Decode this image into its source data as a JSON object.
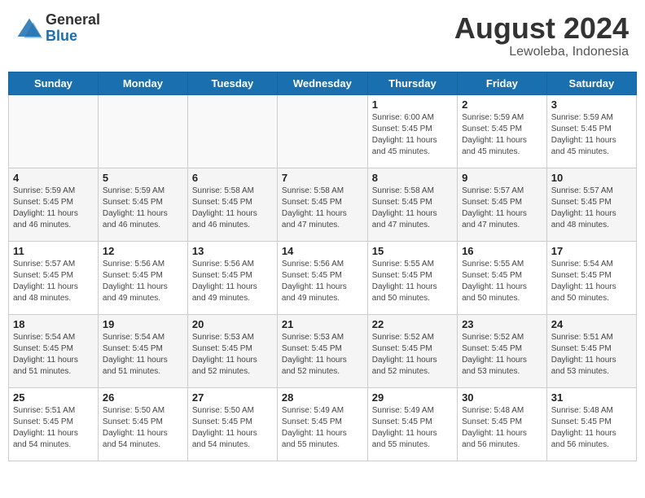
{
  "header": {
    "logo_general": "General",
    "logo_blue": "Blue",
    "month_year": "August 2024",
    "location": "Lewoleba, Indonesia"
  },
  "days_of_week": [
    "Sunday",
    "Monday",
    "Tuesday",
    "Wednesday",
    "Thursday",
    "Friday",
    "Saturday"
  ],
  "weeks": [
    [
      {
        "day": "",
        "info": ""
      },
      {
        "day": "",
        "info": ""
      },
      {
        "day": "",
        "info": ""
      },
      {
        "day": "",
        "info": ""
      },
      {
        "day": "1",
        "info": "Sunrise: 6:00 AM\nSunset: 5:45 PM\nDaylight: 11 hours\nand 45 minutes."
      },
      {
        "day": "2",
        "info": "Sunrise: 5:59 AM\nSunset: 5:45 PM\nDaylight: 11 hours\nand 45 minutes."
      },
      {
        "day": "3",
        "info": "Sunrise: 5:59 AM\nSunset: 5:45 PM\nDaylight: 11 hours\nand 45 minutes."
      }
    ],
    [
      {
        "day": "4",
        "info": "Sunrise: 5:59 AM\nSunset: 5:45 PM\nDaylight: 11 hours\nand 46 minutes."
      },
      {
        "day": "5",
        "info": "Sunrise: 5:59 AM\nSunset: 5:45 PM\nDaylight: 11 hours\nand 46 minutes."
      },
      {
        "day": "6",
        "info": "Sunrise: 5:58 AM\nSunset: 5:45 PM\nDaylight: 11 hours\nand 46 minutes."
      },
      {
        "day": "7",
        "info": "Sunrise: 5:58 AM\nSunset: 5:45 PM\nDaylight: 11 hours\nand 47 minutes."
      },
      {
        "day": "8",
        "info": "Sunrise: 5:58 AM\nSunset: 5:45 PM\nDaylight: 11 hours\nand 47 minutes."
      },
      {
        "day": "9",
        "info": "Sunrise: 5:57 AM\nSunset: 5:45 PM\nDaylight: 11 hours\nand 47 minutes."
      },
      {
        "day": "10",
        "info": "Sunrise: 5:57 AM\nSunset: 5:45 PM\nDaylight: 11 hours\nand 48 minutes."
      }
    ],
    [
      {
        "day": "11",
        "info": "Sunrise: 5:57 AM\nSunset: 5:45 PM\nDaylight: 11 hours\nand 48 minutes."
      },
      {
        "day": "12",
        "info": "Sunrise: 5:56 AM\nSunset: 5:45 PM\nDaylight: 11 hours\nand 49 minutes."
      },
      {
        "day": "13",
        "info": "Sunrise: 5:56 AM\nSunset: 5:45 PM\nDaylight: 11 hours\nand 49 minutes."
      },
      {
        "day": "14",
        "info": "Sunrise: 5:56 AM\nSunset: 5:45 PM\nDaylight: 11 hours\nand 49 minutes."
      },
      {
        "day": "15",
        "info": "Sunrise: 5:55 AM\nSunset: 5:45 PM\nDaylight: 11 hours\nand 50 minutes."
      },
      {
        "day": "16",
        "info": "Sunrise: 5:55 AM\nSunset: 5:45 PM\nDaylight: 11 hours\nand 50 minutes."
      },
      {
        "day": "17",
        "info": "Sunrise: 5:54 AM\nSunset: 5:45 PM\nDaylight: 11 hours\nand 50 minutes."
      }
    ],
    [
      {
        "day": "18",
        "info": "Sunrise: 5:54 AM\nSunset: 5:45 PM\nDaylight: 11 hours\nand 51 minutes."
      },
      {
        "day": "19",
        "info": "Sunrise: 5:54 AM\nSunset: 5:45 PM\nDaylight: 11 hours\nand 51 minutes."
      },
      {
        "day": "20",
        "info": "Sunrise: 5:53 AM\nSunset: 5:45 PM\nDaylight: 11 hours\nand 52 minutes."
      },
      {
        "day": "21",
        "info": "Sunrise: 5:53 AM\nSunset: 5:45 PM\nDaylight: 11 hours\nand 52 minutes."
      },
      {
        "day": "22",
        "info": "Sunrise: 5:52 AM\nSunset: 5:45 PM\nDaylight: 11 hours\nand 52 minutes."
      },
      {
        "day": "23",
        "info": "Sunrise: 5:52 AM\nSunset: 5:45 PM\nDaylight: 11 hours\nand 53 minutes."
      },
      {
        "day": "24",
        "info": "Sunrise: 5:51 AM\nSunset: 5:45 PM\nDaylight: 11 hours\nand 53 minutes."
      }
    ],
    [
      {
        "day": "25",
        "info": "Sunrise: 5:51 AM\nSunset: 5:45 PM\nDaylight: 11 hours\nand 54 minutes."
      },
      {
        "day": "26",
        "info": "Sunrise: 5:50 AM\nSunset: 5:45 PM\nDaylight: 11 hours\nand 54 minutes."
      },
      {
        "day": "27",
        "info": "Sunrise: 5:50 AM\nSunset: 5:45 PM\nDaylight: 11 hours\nand 54 minutes."
      },
      {
        "day": "28",
        "info": "Sunrise: 5:49 AM\nSunset: 5:45 PM\nDaylight: 11 hours\nand 55 minutes."
      },
      {
        "day": "29",
        "info": "Sunrise: 5:49 AM\nSunset: 5:45 PM\nDaylight: 11 hours\nand 55 minutes."
      },
      {
        "day": "30",
        "info": "Sunrise: 5:48 AM\nSunset: 5:45 PM\nDaylight: 11 hours\nand 56 minutes."
      },
      {
        "day": "31",
        "info": "Sunrise: 5:48 AM\nSunset: 5:45 PM\nDaylight: 11 hours\nand 56 minutes."
      }
    ]
  ]
}
